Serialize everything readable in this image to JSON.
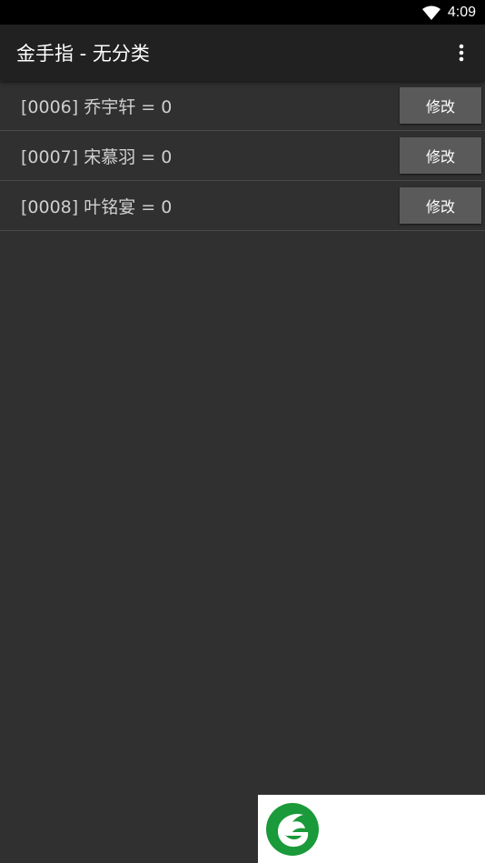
{
  "status_bar": {
    "time": "4:09",
    "wifi_icon": "wifi-icon"
  },
  "app_bar": {
    "title": "金手指 - 无分类",
    "overflow_icon": "more-vert-icon"
  },
  "cheats": [
    {
      "label": "[0006] 乔宇轩 = 0",
      "button_label": "修改"
    },
    {
      "label": "[0007] 宋慕羽 = 0",
      "button_label": "修改"
    },
    {
      "label": "[0008] 叶铭宴 = 0",
      "button_label": "修改"
    }
  ],
  "colors": {
    "background": "#303030",
    "app_bar": "#212121",
    "status_bar": "#000000",
    "button": "#5a5a5a",
    "logo_green": "#1a9a3a"
  },
  "watermark_logo": "leaf-logo-icon"
}
